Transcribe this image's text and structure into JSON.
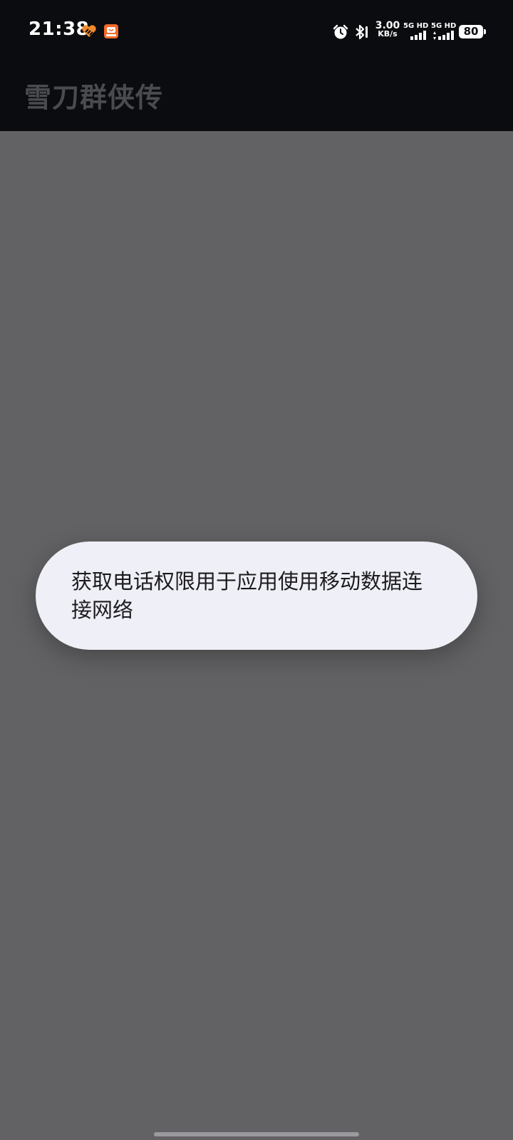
{
  "status_bar": {
    "time": "21:38",
    "net_speed_value": "3.00",
    "net_speed_unit": "KB/s",
    "sim1_label": "5G HD",
    "sim2_label": "5G HD",
    "battery_level": "80",
    "icons": [
      "orange-heart-app-icon",
      "orange-shop-app-icon",
      "alarm-icon",
      "bluetooth-icon",
      "signal-icon",
      "battery-icon"
    ]
  },
  "app_bar": {
    "title": "雪刀群侠传"
  },
  "toast": {
    "message": "获取电话权限用于应用使用移动数据连接网络"
  },
  "colors": {
    "status_bar_bg": "#0b0c0f",
    "content_bg": "#626264",
    "toast_bg": "#efeff7",
    "title_color": "#4a4b4f",
    "notif_accent": "#f28a2b"
  }
}
